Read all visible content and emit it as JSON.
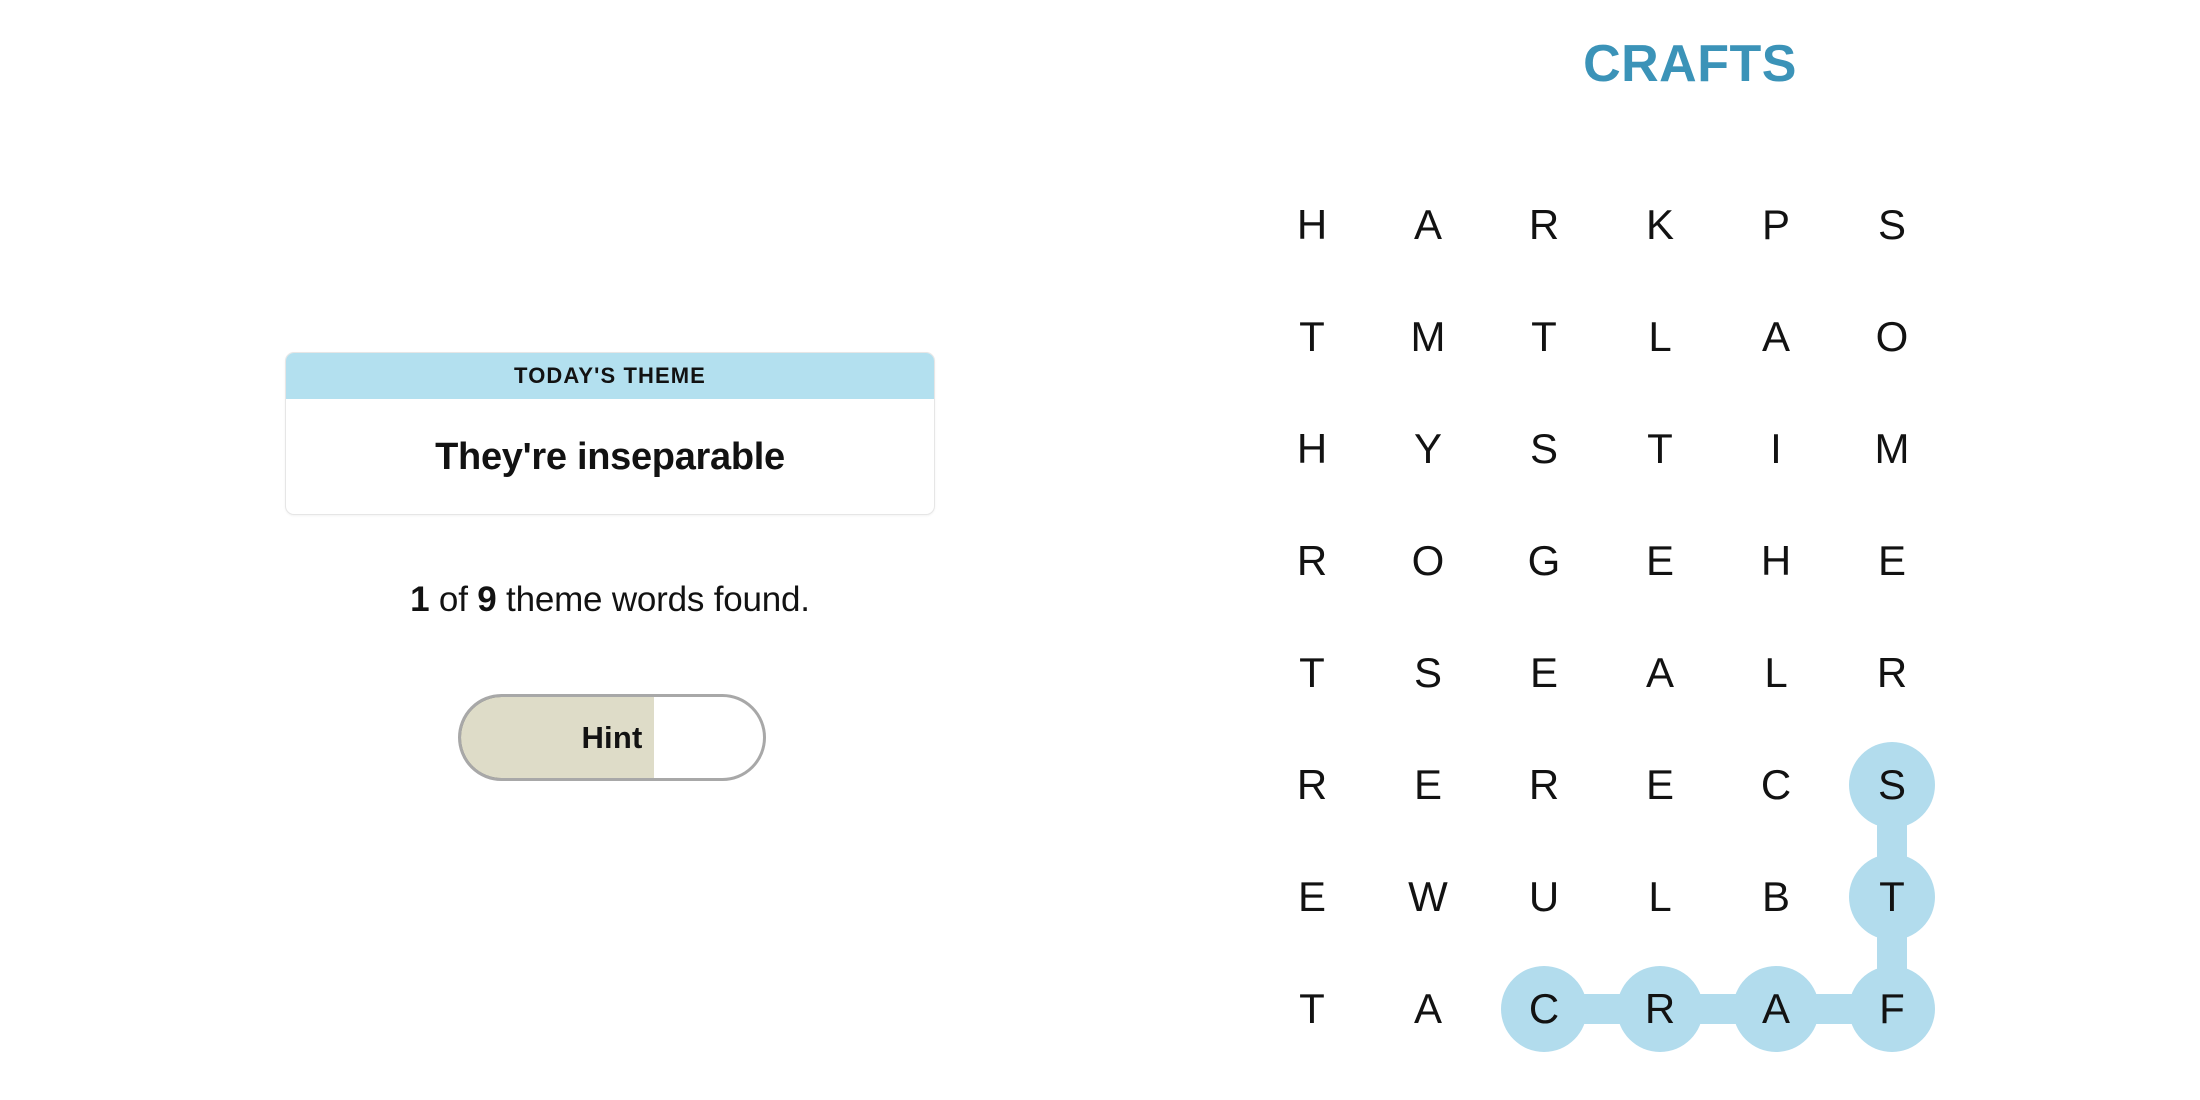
{
  "board": {
    "title": "CRAFTS",
    "title_color": "#3b93b8",
    "highlight_color": "#b2dced",
    "columns": 6,
    "rows": 8,
    "letters": [
      [
        "H",
        "A",
        "R",
        "K",
        "P",
        "S"
      ],
      [
        "T",
        "M",
        "T",
        "L",
        "A",
        "O"
      ],
      [
        "H",
        "Y",
        "S",
        "T",
        "I",
        "M"
      ],
      [
        "R",
        "O",
        "G",
        "E",
        "H",
        "E"
      ],
      [
        "T",
        "S",
        "E",
        "A",
        "L",
        "R"
      ],
      [
        "R",
        "E",
        "R",
        "E",
        "C",
        "S"
      ],
      [
        "E",
        "W",
        "U",
        "L",
        "B",
        "T"
      ],
      [
        "T",
        "A",
        "C",
        "R",
        "A",
        "F"
      ]
    ],
    "found_word_path": [
      {
        "row": 7,
        "col": 2,
        "letter": "C"
      },
      {
        "row": 7,
        "col": 3,
        "letter": "R"
      },
      {
        "row": 7,
        "col": 4,
        "letter": "A"
      },
      {
        "row": 7,
        "col": 5,
        "letter": "F"
      },
      {
        "row": 6,
        "col": 5,
        "letter": "T"
      },
      {
        "row": 5,
        "col": 5,
        "letter": "S"
      }
    ],
    "found_word": "CRAFTS"
  },
  "theme_card": {
    "header_label": "TODAY'S THEME",
    "header_color": "#b3e0ef",
    "clue": "They're inseparable"
  },
  "progress": {
    "found_count": "1",
    "total_count": "9",
    "middle_text": " of ",
    "suffix_text": " theme words found."
  },
  "hint_button": {
    "label": "Hint",
    "fill_percent": 65,
    "fill_color": "#dedcc8"
  }
}
